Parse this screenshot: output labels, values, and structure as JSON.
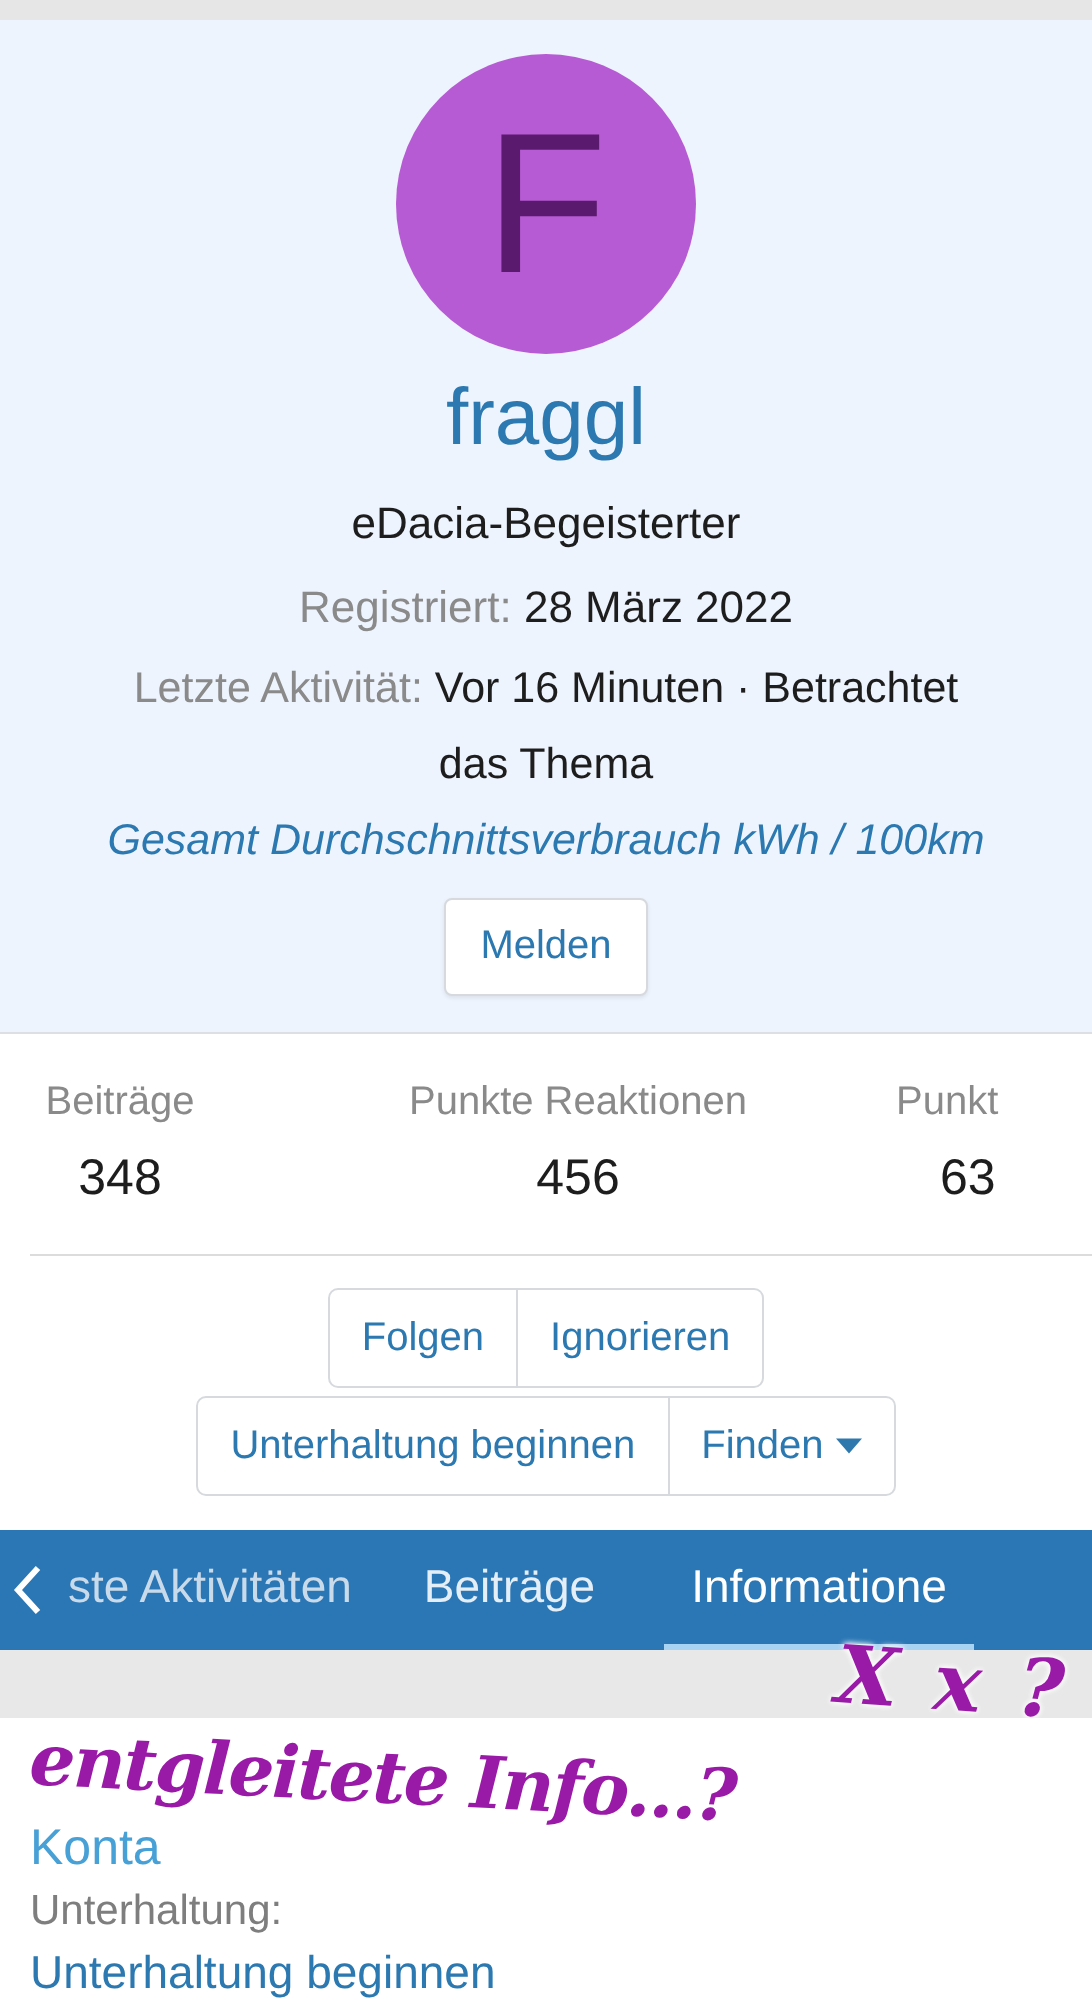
{
  "profile": {
    "avatar_letter": "F",
    "username": "fraggl",
    "user_title": "eDacia-Begeisterter",
    "registered_label": "Registriert:",
    "registered_value": "28 März 2022",
    "activity_label": "Letzte Aktivität:",
    "activity_value": "Vor 16 Minuten · Betrachtet das Thema",
    "activity_link": "Gesamt Durchschnittsverbrauch kWh / 100km",
    "report_button": "Melden"
  },
  "stats": [
    {
      "label": "Beiträge",
      "value": "348"
    },
    {
      "label": "Punkte Reaktionen",
      "value": "456"
    },
    {
      "label": "Punkt",
      "value": "63"
    }
  ],
  "button_groups": [
    [
      {
        "label": "Folgen"
      },
      {
        "label": "Ignorieren"
      }
    ],
    [
      {
        "label": "Unterhaltung beginnen"
      },
      {
        "label": "Finden",
        "dropdown": true
      }
    ]
  ],
  "tabs": [
    {
      "label": "ste Aktivitäten",
      "selected": false
    },
    {
      "label": "Beiträge",
      "selected": false
    },
    {
      "label": "Informatione",
      "selected": true
    }
  ],
  "info": {
    "heading": "Konta",
    "field_label": "Unterhaltung:",
    "field_link": "Unterhaltung beginnen"
  },
  "annotation": {
    "line_1": "X x ?",
    "line_2": "entgleitete Info...?"
  }
}
